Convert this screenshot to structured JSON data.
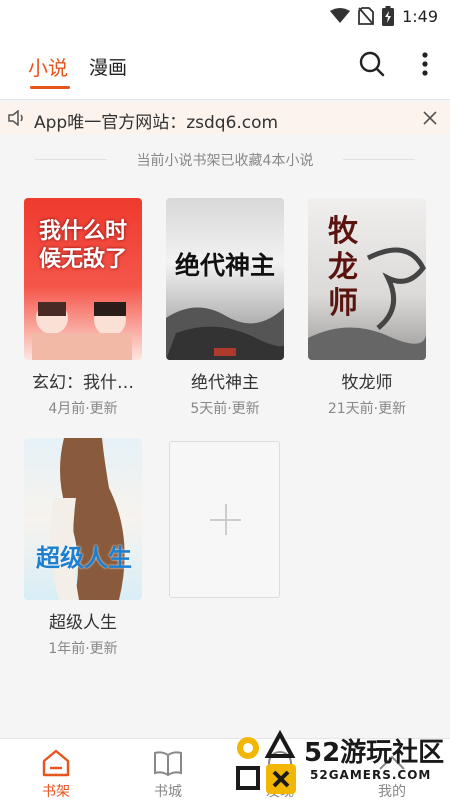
{
  "status_bar": {
    "time": "1:49"
  },
  "header": {
    "tabs": [
      {
        "label": "小说",
        "active": true
      },
      {
        "label": "漫画",
        "active": false
      }
    ],
    "accent": "#e8541e"
  },
  "notice": {
    "text": "App唯一官方网站：zsdq6.com"
  },
  "shelf": {
    "info": "当前小说书架已收藏4本小说"
  },
  "books": [
    {
      "title": "玄幻：我什…",
      "meta": "4月前·更新",
      "cover_text": "我什么时候无敌了"
    },
    {
      "title": "绝代神主",
      "meta": "5天前·更新",
      "cover_text": "绝代神主"
    },
    {
      "title": "牧龙师",
      "meta": "21天前·更新",
      "cover_text": "牧龙师"
    },
    {
      "title": "超级人生",
      "meta": "1年前·更新",
      "cover_text": "超级人生"
    }
  ],
  "nav": [
    {
      "label": "书架",
      "active": true,
      "icon": "bookshelf-icon"
    },
    {
      "label": "书城",
      "active": false,
      "icon": "book-icon"
    },
    {
      "label": "发现",
      "active": false,
      "icon": "discover-icon"
    },
    {
      "label": "我的",
      "active": false,
      "icon": "profile-icon"
    }
  ],
  "watermark": {
    "name": "52游玩社区",
    "url": "52GAMERS.COM"
  }
}
